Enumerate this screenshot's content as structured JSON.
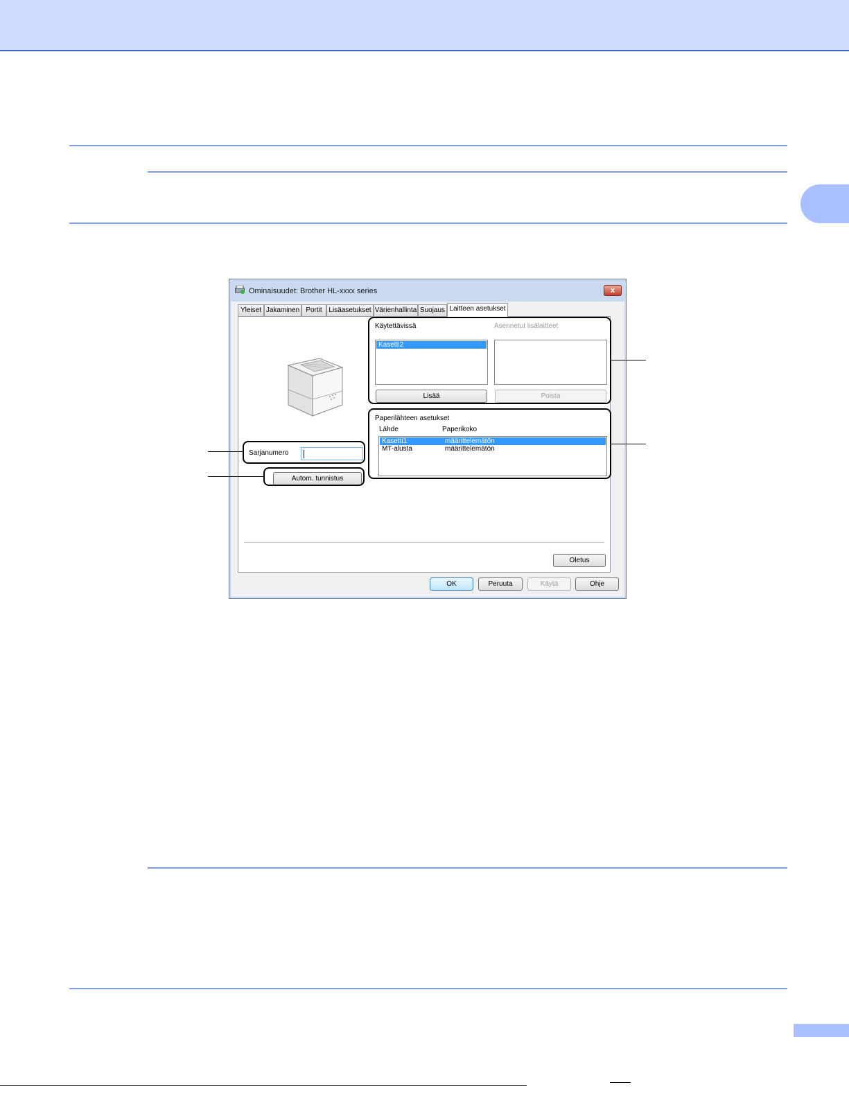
{
  "dialog": {
    "title": "Ominaisuudet: Brother HL-xxxx series",
    "close_glyph": "x",
    "tabs": [
      "Yleiset",
      "Jakaminen",
      "Portit",
      "Lisäasetukset",
      "Värienhallinta",
      "Suojaus",
      "Laitteen asetukset"
    ],
    "active_tab": "Laitteen asetukset",
    "available_label": "Käytettävissä",
    "installed_label": "Asennetut lisälaitteet",
    "available_items": [
      "Kasetti2"
    ],
    "add_button": "Lisää",
    "remove_button": "Poista",
    "paper_source_label": "Paperilähteen asetukset",
    "source_header": "Lähde",
    "size_header": "Paperikoko",
    "paper_rows": [
      {
        "source": "Kasetti1",
        "size": "määrittelemätön"
      },
      {
        "source": "MT-alusta",
        "size": "määrittelemätön"
      }
    ],
    "serial_label": "Sarjanumero",
    "serial_value": "",
    "auto_detect_button": "Autom. tunnistus",
    "default_button": "Oletus",
    "ok_button": "OK",
    "cancel_button": "Peruuta",
    "apply_button": "Käytä",
    "help_button": "Ohje"
  },
  "colors": {
    "header_band": "#cfdcff",
    "accent_line": "#7f9ef0",
    "selection": "#3399ff"
  }
}
